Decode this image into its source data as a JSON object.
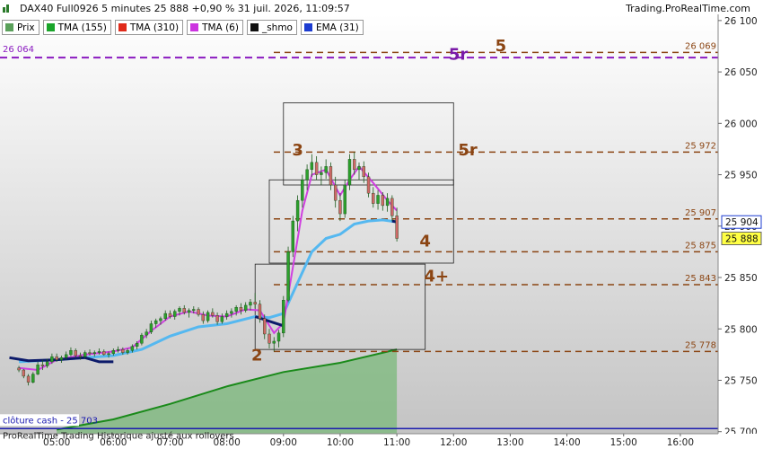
{
  "header": {
    "title": "DAX40 Full0926 5 minutes 25 888 +0,90 % 31 juil. 2026, 11:09:57",
    "brand": "Trading.ProRealTime.com"
  },
  "legend": [
    {
      "name": "Prix",
      "color": "#5aa05a"
    },
    {
      "name": "TMA (155)",
      "color": "#1aa52a"
    },
    {
      "name": "TMA (310)",
      "color": "#e02a1a"
    },
    {
      "name": "TMA (6)",
      "color": "#cc33e0"
    },
    {
      "name": "_shmo",
      "color": "#111111"
    },
    {
      "name": "EMA (31)",
      "color": "#1c3cd0"
    }
  ],
  "footer": {
    "close_label": "clôture cash -  25 703",
    "provider": "ProRealTime Trading  Historique ajusté aux rollovers"
  },
  "chart_data": {
    "type": "candlestick",
    "x_axis": {
      "ticks": [
        "05:00",
        "06:00",
        "07:00",
        "08:00",
        "09:00",
        "10:00",
        "11:00",
        "12:00",
        "13:00",
        "14:00",
        "15:00",
        "16:00"
      ]
    },
    "y_axis": {
      "range": [
        25700,
        26100
      ],
      "ticks": [
        "25 700",
        "25 750",
        "25 800",
        "25 850",
        "25 900",
        "25 950",
        "26 000",
        "26 050",
        "26 100"
      ]
    },
    "levels": [
      {
        "value": 26069,
        "label": "26 069",
        "color": "#8b4513"
      },
      {
        "value": 26064,
        "label": "26 064",
        "color": "#8a1ac0"
      },
      {
        "value": 25972,
        "label": "25 972",
        "color": "#8b4513"
      },
      {
        "value": 25907,
        "label": "25 907",
        "color": "#8b4513"
      },
      {
        "value": 25875,
        "label": "25 875",
        "color": "#8b4513"
      },
      {
        "value": 25843,
        "label": "25 843",
        "color": "#8b4513"
      },
      {
        "value": 25778,
        "label": "25 778",
        "color": "#8b4513"
      },
      {
        "value": 25703,
        "label": "25 703",
        "color": "#1c1cb0"
      }
    ],
    "price_tags": [
      {
        "value": 25904,
        "label": "25 904",
        "bg": "#ffffff",
        "border": "#1c3cd0"
      },
      {
        "value": 25888,
        "label": "25 888",
        "bg": "#ffff44",
        "border": "#666666"
      }
    ],
    "wave_labels": [
      {
        "text": "5",
        "time": "12:50",
        "price": 26070
      },
      {
        "text": "5r",
        "time": "12:05",
        "price": 26062
      },
      {
        "text": "5r",
        "time": "12:15",
        "price": 25969
      },
      {
        "text": "3",
        "time": "09:15",
        "price": 25969
      },
      {
        "text": "4",
        "time": "11:30",
        "price": 25880
      },
      {
        "text": "4+",
        "time": "11:42",
        "price": 25846
      },
      {
        "text": "2",
        "time": "08:32",
        "price": 25769
      }
    ],
    "boxes": [
      {
        "t0": "09:00",
        "t1": "12:00",
        "p0": 25940,
        "p1": 26020
      },
      {
        "t0": "08:45",
        "t1": "12:00",
        "p0": 25864,
        "p1": 25945
      },
      {
        "t0": "08:30",
        "t1": "11:30",
        "p0": 25780,
        "p1": 25863
      }
    ],
    "ohlc": [
      [
        "04:20",
        25762,
        25764,
        25758,
        25760
      ],
      [
        "04:25",
        25760,
        25761,
        25752,
        25754
      ],
      [
        "04:30",
        25754,
        25756,
        25745,
        25748
      ],
      [
        "04:35",
        25748,
        25758,
        25747,
        25756
      ],
      [
        "04:40",
        25756,
        25768,
        25755,
        25765
      ],
      [
        "04:45",
        25765,
        25770,
        25760,
        25764
      ],
      [
        "04:50",
        25764,
        25771,
        25762,
        25768
      ],
      [
        "04:55",
        25768,
        25776,
        25766,
        25773
      ],
      [
        "05:00",
        25773,
        25776,
        25768,
        25770
      ],
      [
        "05:05",
        25770,
        25774,
        25767,
        25772
      ],
      [
        "05:10",
        25772,
        25778,
        25770,
        25775
      ],
      [
        "05:15",
        25775,
        25782,
        25773,
        25779
      ],
      [
        "05:20",
        25779,
        25781,
        25772,
        25774
      ],
      [
        "05:25",
        25774,
        25777,
        25770,
        25773
      ],
      [
        "05:30",
        25773,
        25779,
        25771,
        25777
      ],
      [
        "05:35",
        25777,
        25780,
        25774,
        25776
      ],
      [
        "05:40",
        25776,
        25779,
        25773,
        25777
      ],
      [
        "05:45",
        25777,
        25781,
        25775,
        25778
      ],
      [
        "05:50",
        25778,
        25780,
        25774,
        25775
      ],
      [
        "05:55",
        25775,
        25778,
        25772,
        25776
      ],
      [
        "06:00",
        25776,
        25781,
        25774,
        25779
      ],
      [
        "06:05",
        25779,
        25783,
        25777,
        25780
      ],
      [
        "06:10",
        25780,
        25782,
        25775,
        25777
      ],
      [
        "06:15",
        25777,
        25781,
        25775,
        25779
      ],
      [
        "06:20",
        25779,
        25785,
        25777,
        25783
      ],
      [
        "06:25",
        25783,
        25788,
        25780,
        25786
      ],
      [
        "06:30",
        25786,
        25796,
        25784,
        25794
      ],
      [
        "06:35",
        25794,
        25800,
        25791,
        25797
      ],
      [
        "06:40",
        25797,
        25808,
        25795,
        25805
      ],
      [
        "06:45",
        25805,
        25810,
        25801,
        25808
      ],
      [
        "06:50",
        25808,
        25812,
        25804,
        25810
      ],
      [
        "06:55",
        25810,
        25818,
        25808,
        25815
      ],
      [
        "07:00",
        25815,
        25818,
        25810,
        25812
      ],
      [
        "07:05",
        25812,
        25819,
        25809,
        25817
      ],
      [
        "07:10",
        25817,
        25822,
        25813,
        25820
      ],
      [
        "07:15",
        25820,
        25823,
        25814,
        25816
      ],
      [
        "07:20",
        25816,
        25820,
        25811,
        25818
      ],
      [
        "07:25",
        25818,
        25822,
        25815,
        25819
      ],
      [
        "07:30",
        25819,
        25821,
        25812,
        25814
      ],
      [
        "07:35",
        25814,
        25817,
        25805,
        25808
      ],
      [
        "07:40",
        25808,
        25818,
        25806,
        25816
      ],
      [
        "07:45",
        25816,
        25820,
        25811,
        25813
      ],
      [
        "07:50",
        25813,
        25816,
        25804,
        25807
      ],
      [
        "07:55",
        25807,
        25815,
        25805,
        25812
      ],
      [
        "08:00",
        25812,
        25818,
        25809,
        25815
      ],
      [
        "08:05",
        25815,
        25820,
        25811,
        25817
      ],
      [
        "08:10",
        25817,
        25823,
        25813,
        25821
      ],
      [
        "08:15",
        25821,
        25825,
        25814,
        25818
      ],
      [
        "08:20",
        25818,
        25826,
        25816,
        25823
      ],
      [
        "08:25",
        25823,
        25829,
        25818,
        25826
      ],
      [
        "08:30",
        25826,
        25835,
        25820,
        25824
      ],
      [
        "08:35",
        25824,
        25828,
        25806,
        25810
      ],
      [
        "08:40",
        25810,
        25814,
        25790,
        25795
      ],
      [
        "08:45",
        25795,
        25800,
        25781,
        25786
      ],
      [
        "08:50",
        25786,
        25792,
        25778,
        25788
      ],
      [
        "08:55",
        25788,
        25799,
        25782,
        25796
      ],
      [
        "09:00",
        25796,
        25832,
        25792,
        25828
      ],
      [
        "09:05",
        25828,
        25880,
        25826,
        25875
      ],
      [
        "09:10",
        25875,
        25910,
        25870,
        25905
      ],
      [
        "09:15",
        25905,
        25930,
        25895,
        25925
      ],
      [
        "09:20",
        25925,
        25950,
        25918,
        25945
      ],
      [
        "09:25",
        25945,
        25960,
        25935,
        25955
      ],
      [
        "09:30",
        25955,
        25970,
        25948,
        25962
      ],
      [
        "09:35",
        25962,
        25968,
        25945,
        25950
      ],
      [
        "09:40",
        25950,
        25958,
        25940,
        25952
      ],
      [
        "09:45",
        25952,
        25965,
        25946,
        25958
      ],
      [
        "09:50",
        25958,
        25962,
        25935,
        25940
      ],
      [
        "09:55",
        25940,
        25948,
        25918,
        25925
      ],
      [
        "10:00",
        25925,
        25932,
        25905,
        25912
      ],
      [
        "10:05",
        25912,
        25945,
        25908,
        25940
      ],
      [
        "10:10",
        25940,
        25970,
        25935,
        25965
      ],
      [
        "10:15",
        25965,
        25972,
        25950,
        25955
      ],
      [
        "10:20",
        25955,
        25962,
        25945,
        25958
      ],
      [
        "10:25",
        25958,
        25963,
        25942,
        25948
      ],
      [
        "10:30",
        25948,
        25952,
        25928,
        25932
      ],
      [
        "10:35",
        25932,
        25938,
        25918,
        25922
      ],
      [
        "10:40",
        25922,
        25935,
        25916,
        25930
      ],
      [
        "10:45",
        25930,
        25933,
        25915,
        25920
      ],
      [
        "10:50",
        25920,
        25932,
        25914,
        25927
      ],
      [
        "10:55",
        25927,
        25930,
        25905,
        25910
      ],
      [
        "11:00",
        25910,
        25918,
        25885,
        25888
      ]
    ],
    "tma_short": [
      [
        "04:20",
        25762
      ],
      [
        "04:40",
        25760
      ],
      [
        "05:00",
        25770
      ],
      [
        "05:30",
        25775
      ],
      [
        "06:00",
        25778
      ],
      [
        "06:20",
        25782
      ],
      [
        "06:40",
        25798
      ],
      [
        "07:00",
        25812
      ],
      [
        "07:20",
        25817
      ],
      [
        "07:40",
        25813
      ],
      [
        "08:00",
        25812
      ],
      [
        "08:20",
        25819
      ],
      [
        "08:35",
        25818
      ],
      [
        "08:50",
        25796
      ],
      [
        "09:00",
        25806
      ],
      [
        "09:10",
        25860
      ],
      [
        "09:20",
        25915
      ],
      [
        "09:30",
        25950
      ],
      [
        "09:45",
        25955
      ],
      [
        "10:00",
        25930
      ],
      [
        "10:10",
        25945
      ],
      [
        "10:20",
        25958
      ],
      [
        "10:35",
        25942
      ],
      [
        "10:50",
        25925
      ],
      [
        "11:00",
        25915
      ]
    ],
    "ema": [
      [
        "04:20",
        25768
      ],
      [
        "05:00",
        25770
      ],
      [
        "05:30",
        25772
      ],
      [
        "06:00",
        25774
      ],
      [
        "06:30",
        25780
      ],
      [
        "07:00",
        25793
      ],
      [
        "07:30",
        25802
      ],
      [
        "08:00",
        25805
      ],
      [
        "08:30",
        25812
      ],
      [
        "08:45",
        25811
      ],
      [
        "09:00",
        25815
      ],
      [
        "09:15",
        25845
      ],
      [
        "09:30",
        25875
      ],
      [
        "09:45",
        25888
      ],
      [
        "10:00",
        25892
      ],
      [
        "10:15",
        25902
      ],
      [
        "10:30",
        25905
      ],
      [
        "10:45",
        25906
      ],
      [
        "11:00",
        25904
      ]
    ],
    "shmo": [
      [
        "04:10",
        25772
      ],
      [
        "04:30",
        25769
      ],
      [
        "05:00",
        25770
      ],
      [
        "05:30",
        25772
      ],
      [
        "05:45",
        25768
      ],
      [
        "06:00",
        25768
      ],
      [
        "08:30",
        25812
      ],
      [
        "08:50",
        25806
      ],
      [
        "09:00",
        25803
      ],
      [
        "10:55",
        25905
      ],
      [
        "11:00",
        25904
      ]
    ],
    "tma_long": [
      [
        "05:00",
        25702
      ],
      [
        "06:00",
        25712
      ],
      [
        "07:00",
        25727
      ],
      [
        "08:00",
        25744
      ],
      [
        "09:00",
        25758
      ],
      [
        "10:00",
        25767
      ],
      [
        "11:00",
        25780
      ]
    ]
  }
}
